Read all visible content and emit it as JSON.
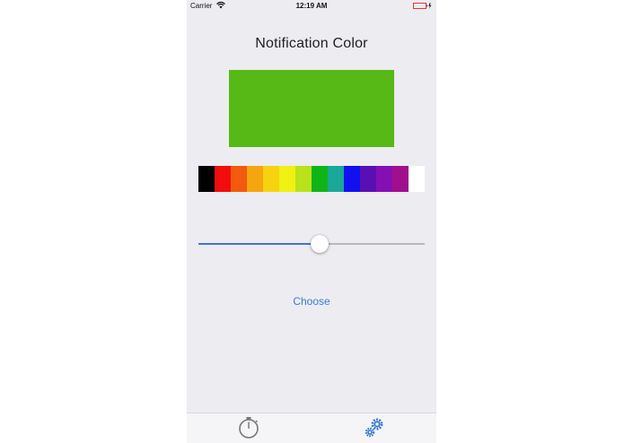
{
  "status_bar": {
    "carrier": "Carrier",
    "time": "12:19 AM",
    "battery_color": "#e0383b"
  },
  "screen": {
    "title": "Notification Color",
    "selected_color": "#56b915",
    "palette": [
      "#000000",
      "#f20d0d",
      "#f25a0d",
      "#f5a50d",
      "#f6d30f",
      "#f0f013",
      "#b9e21a",
      "#10b416",
      "#1aa899",
      "#1010f0",
      "#5a0fb4",
      "#8410b4",
      "#a0108c",
      "#ffffff"
    ],
    "slider_value": 0.54,
    "choose_label": "Choose"
  },
  "tab_bar": {
    "items": [
      {
        "icon": "stopwatch-icon",
        "selected": false,
        "color": "#777777"
      },
      {
        "icon": "gears-icon",
        "selected": true,
        "color": "#3a7bd5"
      }
    ]
  }
}
